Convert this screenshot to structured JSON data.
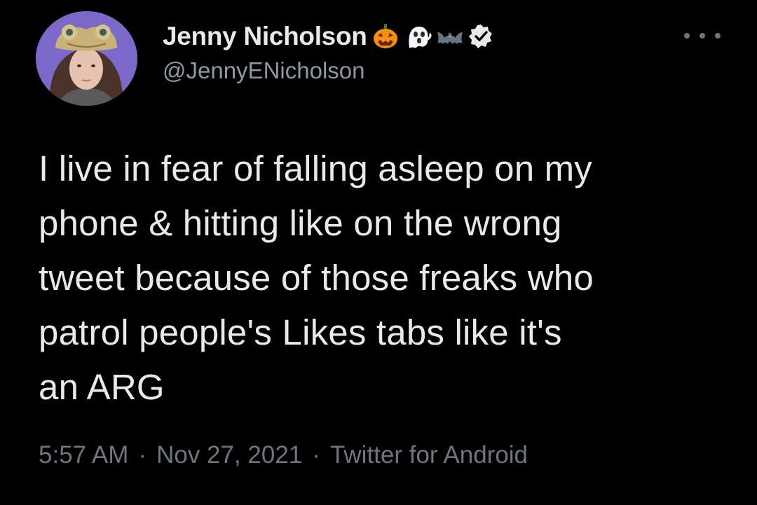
{
  "author": {
    "display_name": "Jenny Nicholson",
    "handle": "@JennyENicholson",
    "name_emojis": [
      "jack-o-lantern-icon",
      "ghost-icon",
      "bat-icon"
    ],
    "verified": true
  },
  "tweet": {
    "text": "I live in fear of falling asleep on my\nphone & hitting like on the wrong\ntweet because of those freaks who\npatrol people's Likes tabs like it's\nan ARG",
    "time": "5:57 AM",
    "date": "Nov 27, 2021",
    "source": "Twitter for Android",
    "separator": "·"
  },
  "colors": {
    "background": "#000000",
    "text_primary": "#e7e9ea",
    "text_secondary": "#6e767d",
    "avatar_bg": "#7b68c9"
  }
}
